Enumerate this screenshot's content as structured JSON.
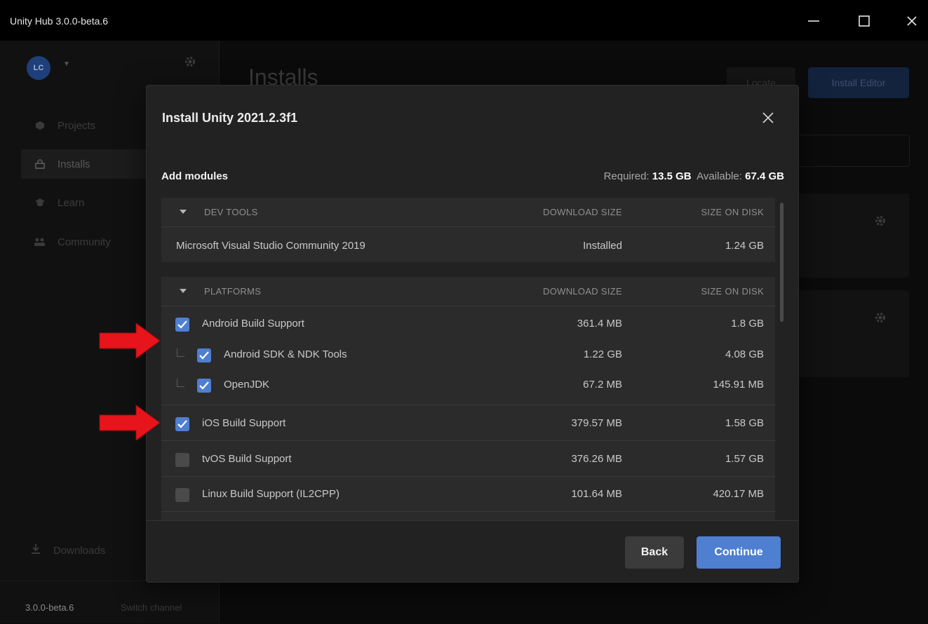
{
  "window": {
    "title": "Unity Hub 3.0.0-beta.6"
  },
  "user": {
    "initials": "LC"
  },
  "sidebar": {
    "items": [
      {
        "label": "Projects",
        "icon": "cube-icon"
      },
      {
        "label": "Installs",
        "icon": "lock-icon",
        "active": true
      },
      {
        "label": "Learn",
        "icon": "graduation-cap-icon"
      },
      {
        "label": "Community",
        "icon": "people-icon"
      }
    ],
    "downloads_label": "Downloads",
    "version": "3.0.0-beta.6",
    "switch_channel": "Switch channel"
  },
  "main": {
    "title": "Installs",
    "locate_label": "Locate",
    "install_editor_label": "Install Editor"
  },
  "modal": {
    "title": "Install Unity 2021.2.3f1",
    "add_modules_label": "Add modules",
    "required_label": "Required:",
    "required_value": "13.5 GB",
    "available_label": "Available:",
    "available_value": "67.4 GB",
    "dev_tools": {
      "header": "DEV TOOLS",
      "col_download": "DOWNLOAD SIZE",
      "col_disk": "SIZE ON DISK",
      "rows": [
        {
          "name": "Microsoft Visual Studio Community 2019",
          "download": "Installed",
          "disk": "1.24 GB"
        }
      ]
    },
    "platforms": {
      "header": "PLATFORMS",
      "col_download": "DOWNLOAD SIZE",
      "col_disk": "SIZE ON DISK",
      "rows": [
        {
          "name": "Android Build Support",
          "download": "361.4 MB",
          "disk": "1.8 GB",
          "checked": true
        },
        {
          "name": "Android SDK & NDK Tools",
          "download": "1.22 GB",
          "disk": "4.08 GB",
          "checked": true,
          "child": true
        },
        {
          "name": "OpenJDK",
          "download": "67.2 MB",
          "disk": "145.91 MB",
          "checked": true,
          "child": true
        },
        {
          "name": "iOS Build Support",
          "download": "379.57 MB",
          "disk": "1.58 GB",
          "checked": true
        },
        {
          "name": "tvOS Build Support",
          "download": "376.26 MB",
          "disk": "1.57 GB",
          "checked": false
        },
        {
          "name": "Linux Build Support (IL2CPP)",
          "download": "101.64 MB",
          "disk": "420.17 MB",
          "checked": false
        }
      ]
    },
    "back_label": "Back",
    "continue_label": "Continue"
  },
  "colors": {
    "accent": "#4e7fd1",
    "annotation_arrow": "#e8141b"
  }
}
